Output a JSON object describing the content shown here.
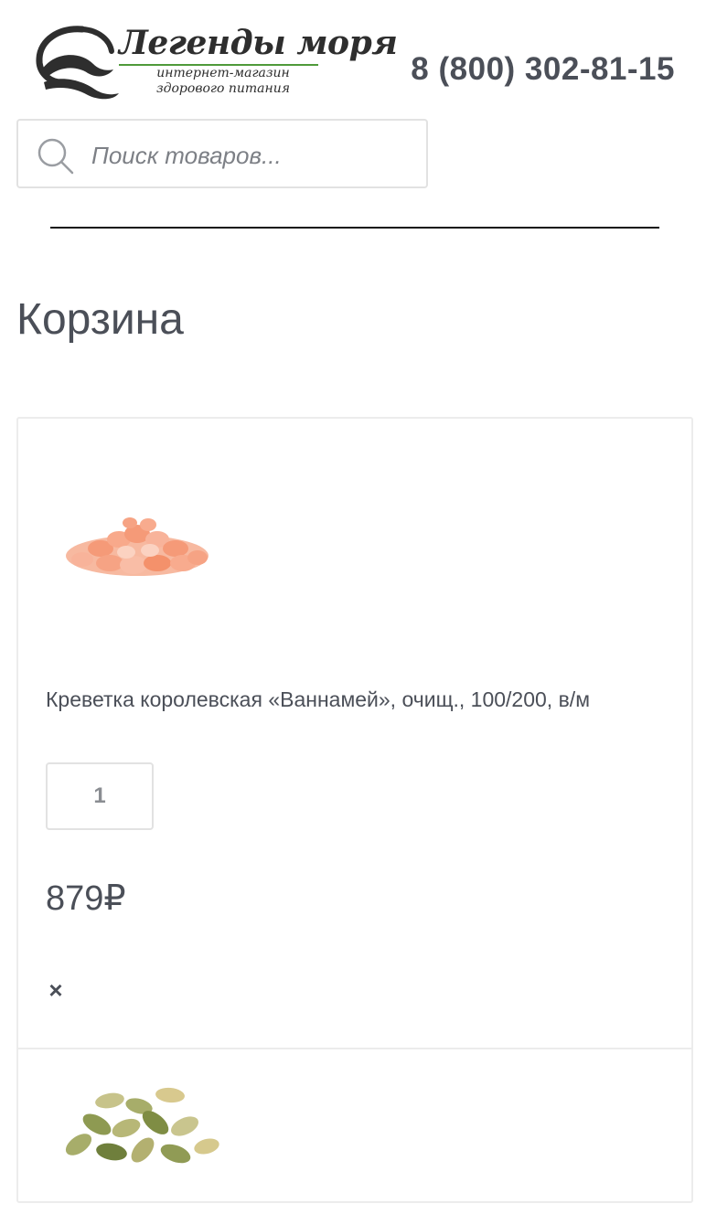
{
  "header": {
    "logo": {
      "title": "Легенды моря",
      "subtitle": "интернет-магазин здорового питания"
    },
    "phone": "8 (800) 302-81-15"
  },
  "search": {
    "placeholder": "Поиск товаров...",
    "value": "",
    "icon": "search-icon"
  },
  "page": {
    "title": "Корзина"
  },
  "cart": {
    "items": [
      {
        "name": "Креветка королевская «Ваннамей», очищ., 100/200, в/м",
        "quantity": "1",
        "price": "879₽",
        "remove_icon": "×"
      }
    ]
  },
  "colors": {
    "text": "#4b4f58",
    "border": "#e2e2e2",
    "logo_accent": "#4f9a3a",
    "shrimp": "#f6a384",
    "seed": "#a7ad6a"
  }
}
